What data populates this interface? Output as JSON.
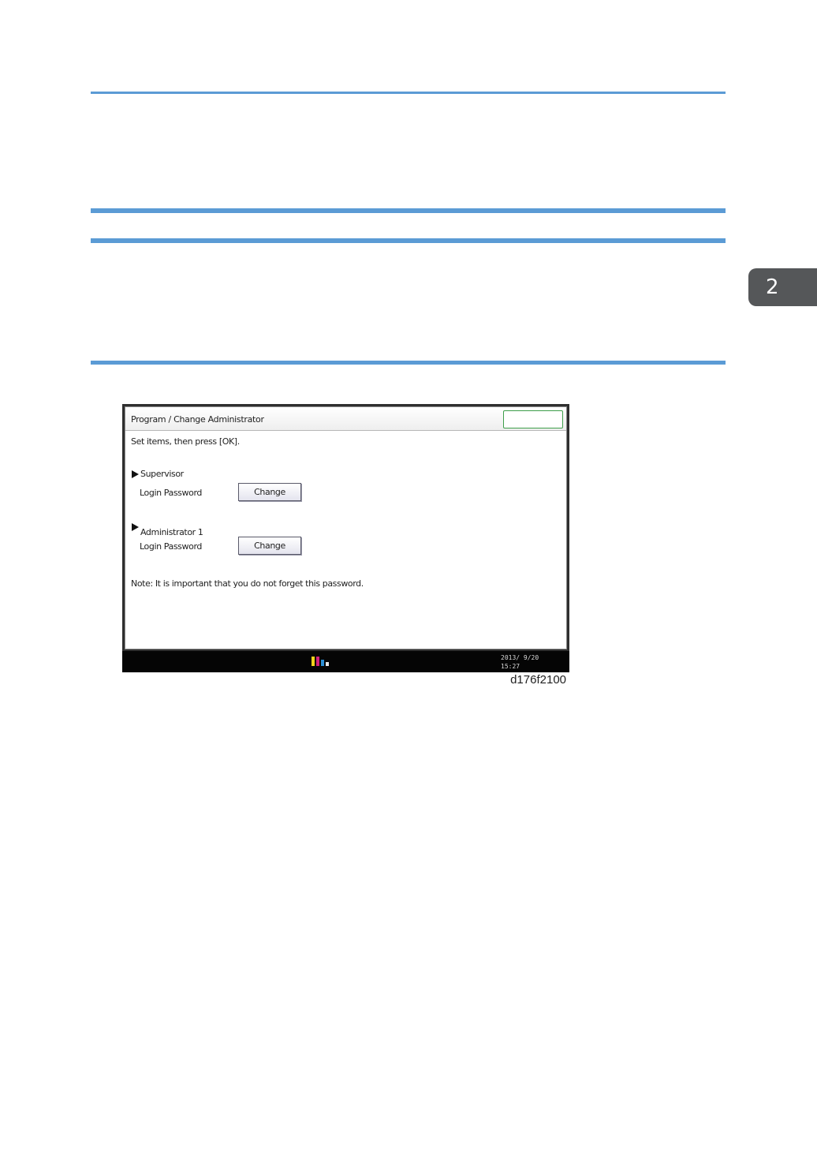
{
  "chapter_tab": "2",
  "screen": {
    "title": "Program / Change Administrator",
    "instruction": "Set items, then press [OK].",
    "supervisor": {
      "heading": "Supervisor",
      "field_label": "Login Password",
      "button_label": "Change"
    },
    "administrator": {
      "heading": "Administrator 1",
      "field_label": "Login Password",
      "button_label": "Change"
    },
    "note": "Note: It is important that you do not forget this password.",
    "date": "2013/ 9/20",
    "time": "15:27"
  },
  "figure_id": "d176f2100",
  "colors": {
    "rule": "#5b9bd5",
    "chapter_tab": "#555759",
    "ok_button_border": "#3e9e4a"
  }
}
